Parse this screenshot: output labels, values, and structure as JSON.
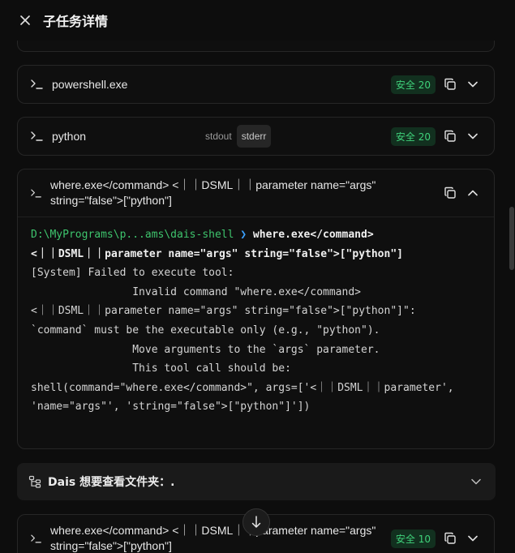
{
  "header": {
    "title": "子任务详情"
  },
  "cards": [
    {
      "title": "powershell.exe",
      "badge": "安全 20"
    },
    {
      "title": "python",
      "badge": "安全 20",
      "tabs": [
        "stdout",
        "stderr"
      ],
      "active_tab": "stderr"
    }
  ],
  "expanded": {
    "title_line1": "where.exe</command> <｜｜DSML｜｜parameter name=\"args\"",
    "title_line2": "string=\"false\">[\"python\"]",
    "terminal": {
      "path": "D:\\MyPrograms\\p...ams\\dais-shell",
      "arrow": "❯",
      "cmd_line1": " where.exe</command>",
      "cmd_line2": "<｜｜DSML｜｜parameter name=\"args\" string=\"false\">[\"python\"]",
      "output": [
        "[System] Failed to execute tool:",
        "                Invalid command \"where.exe</command>",
        "<｜｜DSML｜｜parameter name=\"args\" string=\"false\">[\"python\"]\":",
        "`command` must be the executable only (e.g., \"python\").",
        "                Move arguments to the `args` parameter.",
        "                This tool call should be:",
        "shell(command=\"where.exe</command>\", args=['<｜｜DSML｜｜parameter',",
        "'name=\"args\"', 'string=\"false\">[\"python\"]'])"
      ]
    }
  },
  "section": {
    "title": "Dais 想要查看文件夹：."
  },
  "last_card": {
    "title_line1": "where.exe</command> <｜｜DSML｜｜parameter name=\"args\"",
    "title_line2": "string=\"false\">[\"python\"]",
    "badge": "安全 10"
  },
  "colors": {
    "background": "#0d0d0d",
    "badge_bg": "#12301f",
    "badge_text": "#3fd17a",
    "path": "#3ec46d",
    "arrow": "#3aa0ff"
  }
}
